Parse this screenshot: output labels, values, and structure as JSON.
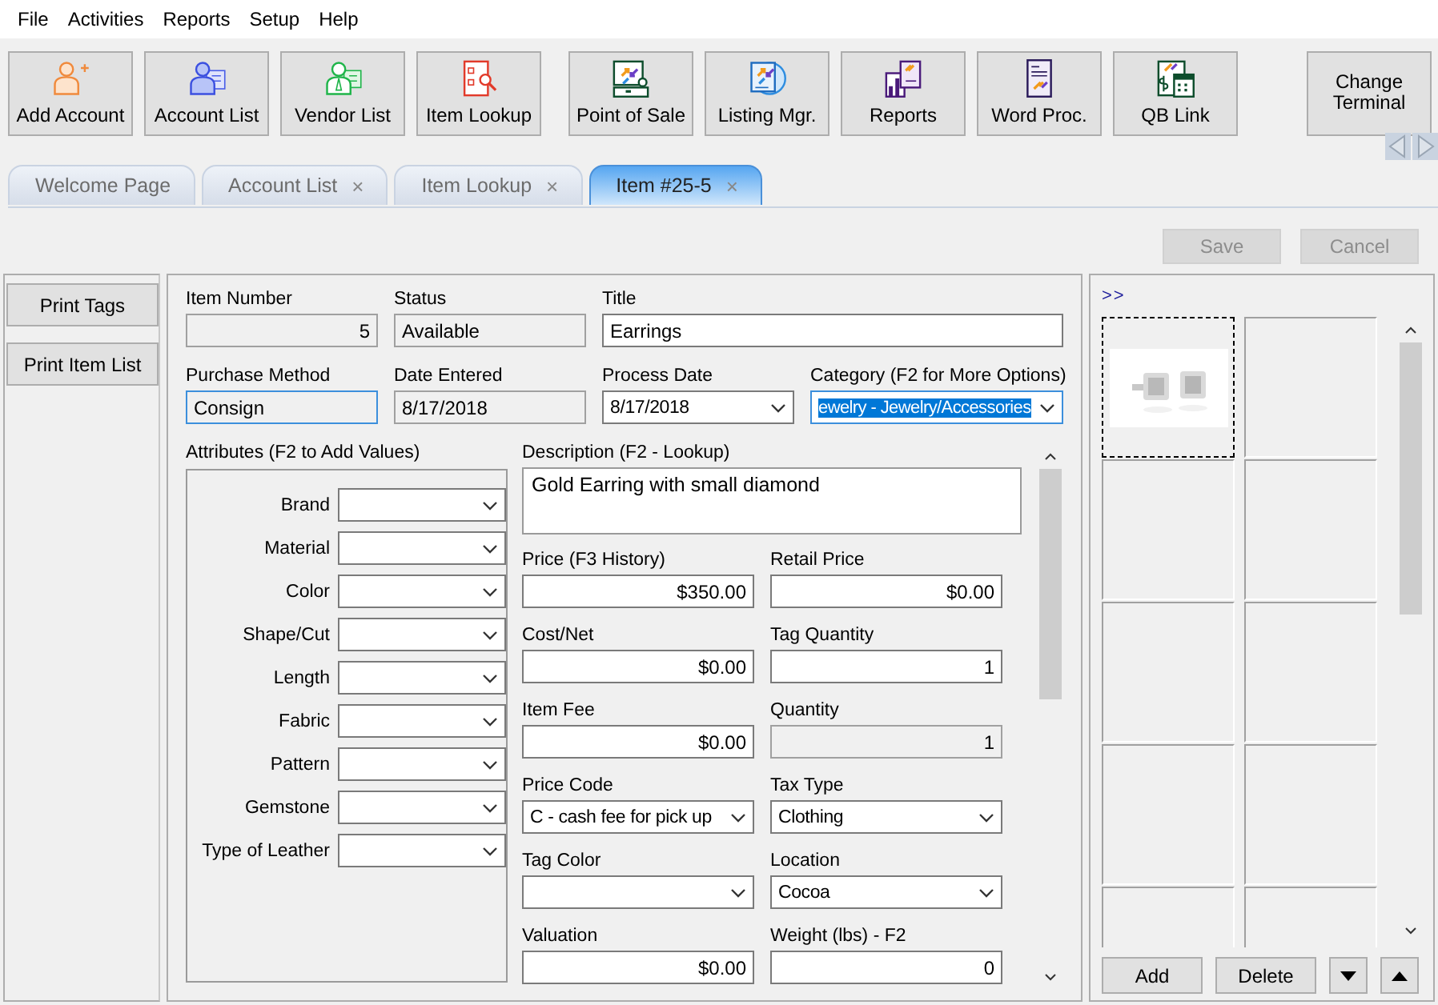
{
  "menu": [
    "File",
    "Activities",
    "Reports",
    "Setup",
    "Help"
  ],
  "toolbar": [
    [
      {
        "label": "Add Account",
        "kind": "adduser"
      },
      {
        "label": "Account List",
        "kind": "userlist"
      },
      {
        "label": "Vendor List",
        "kind": "vendor"
      },
      {
        "label": "Item Lookup",
        "kind": "lookup"
      }
    ],
    [
      {
        "label": "Point of Sale",
        "kind": "register"
      },
      {
        "label": "Listing Mgr.",
        "kind": "globe"
      },
      {
        "label": "Reports",
        "kind": "chart"
      },
      {
        "label": "Word Proc.",
        "kind": "document"
      },
      {
        "label": "QB Link",
        "kind": "ledger"
      }
    ],
    [
      {
        "label": "Change Terminal",
        "kind": "plain"
      }
    ]
  ],
  "tabs": [
    {
      "label": "Welcome Page",
      "selected": false
    },
    {
      "label": "Account List",
      "close": "×",
      "selected": false
    },
    {
      "label": "Item Lookup",
      "close": "×",
      "selected": false
    },
    {
      "label": "Item #25-5",
      "close": "×",
      "selected": true
    }
  ],
  "actions": [
    {
      "label": "Save",
      "disabled": true
    },
    {
      "label": "Cancel",
      "disabled": true
    }
  ],
  "sidebar": [
    {
      "label": "Print Tags"
    },
    {
      "label": "Print Item List"
    }
  ],
  "header_fields": [
    {
      "label": "Item Number",
      "value": "5",
      "kind": "number",
      "disabled": true,
      "focused": false
    },
    {
      "label": "Status",
      "value": "Available",
      "kind": "text",
      "disabled": true,
      "focused": false
    },
    {
      "label": "Title",
      "value": "Earrings",
      "kind": "text",
      "disabled": false,
      "focused": false
    },
    {
      "label": "Purchase Method",
      "value": "Consign",
      "kind": "text",
      "disabled": true,
      "focused": true
    },
    {
      "label": "Date Entered",
      "value": "8/17/2018",
      "kind": "text",
      "disabled": true,
      "focused": false
    },
    {
      "label": "Process Date",
      "value": "8/17/2018",
      "kind": "dropdown",
      "disabled": false,
      "focused": false
    },
    {
      "label": "Category (F2 for More Options)",
      "value": "ewelry - Jewelry/Accessories",
      "kind": "dropdown",
      "disabled": false,
      "focused": true,
      "text_selected": true
    }
  ],
  "attributes": {
    "title": "Attributes (F2 to Add Values)",
    "items": [
      {
        "label": "Brand"
      },
      {
        "label": "Material"
      },
      {
        "label": "Color"
      },
      {
        "label": "Shape/Cut"
      },
      {
        "label": "Length"
      },
      {
        "label": "Fabric"
      },
      {
        "label": "Pattern"
      },
      {
        "label": "Gemstone"
      },
      {
        "label": "Type of Leather"
      }
    ]
  },
  "description": {
    "label": "Description (F2 - Lookup)",
    "value": "Gold Earring with small diamond"
  },
  "details": [
    {
      "label": "Price (F3 History)",
      "value": "$350.00",
      "kind": "number",
      "disabled": false
    },
    {
      "label": "Retail Price",
      "value": "$0.00",
      "kind": "number",
      "disabled": false
    },
    {
      "label": "Cost/Net",
      "value": "$0.00",
      "kind": "number",
      "disabled": false
    },
    {
      "label": "Tag Quantity",
      "value": "1",
      "kind": "number",
      "disabled": false
    },
    {
      "label": "Item Fee",
      "value": "$0.00",
      "kind": "number",
      "disabled": false
    },
    {
      "label": "Quantity",
      "value": "1",
      "kind": "number",
      "disabled": true
    },
    {
      "label": "Price Code",
      "value": "C - cash fee for pick up",
      "kind": "dropdown",
      "disabled": false
    },
    {
      "label": "Tax Type",
      "value": "Clothing",
      "kind": "dropdown",
      "disabled": false
    },
    {
      "label": "Tag Color",
      "kind": "dropdown",
      "disabled": false
    },
    {
      "label": "Location",
      "value": "Cocoa",
      "kind": "dropdown",
      "disabled": false
    },
    {
      "label": "Valuation",
      "value": "$0.00",
      "kind": "number",
      "disabled": false
    },
    {
      "label": "Weight (lbs) - F2",
      "value": "0",
      "kind": "number",
      "disabled": false
    }
  ],
  "photos": {
    "expand": ">>",
    "items": [
      {
        "kind": "picture",
        "selected": true
      },
      {
        "kind": "empty",
        "selected": false
      },
      {
        "kind": "empty",
        "selected": false
      },
      {
        "kind": "empty",
        "selected": false
      },
      {
        "kind": "empty",
        "selected": false
      },
      {
        "kind": "empty",
        "selected": false
      },
      {
        "kind": "empty",
        "selected": false
      },
      {
        "kind": "empty",
        "selected": false
      },
      {
        "kind": "empty",
        "selected": false
      },
      {
        "kind": "empty",
        "selected": false
      }
    ],
    "buttons": [
      {
        "label": "Add"
      },
      {
        "label": "Delete"
      }
    ]
  }
}
